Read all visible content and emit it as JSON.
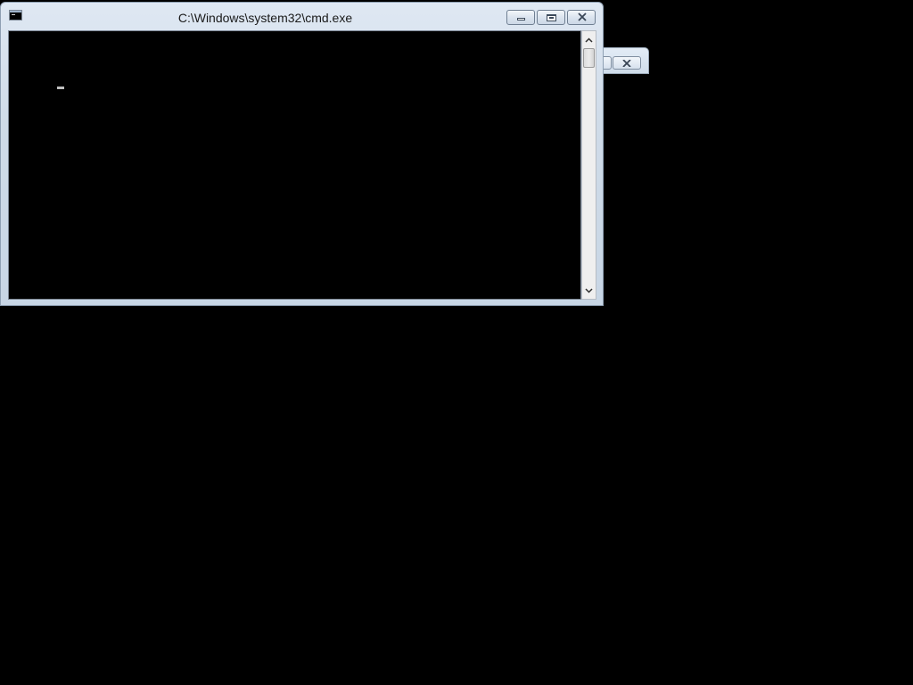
{
  "desktop": {
    "background_color": "#000000"
  },
  "background_window": {
    "buttons": [
      "restore-icon",
      "close-icon"
    ]
  },
  "cmd_window": {
    "title": "C:\\Windows\\system32\\cmd.exe",
    "icon": "console-icon",
    "console_text": "",
    "console_background": "#000000",
    "cursor_color": "#c0c0c0",
    "controls": {
      "minimize": "minimize-icon",
      "maximize": "maximize-icon",
      "close": "close-icon"
    },
    "scrollbar": {
      "up": "chevron-up-icon",
      "down": "chevron-down-icon"
    }
  }
}
